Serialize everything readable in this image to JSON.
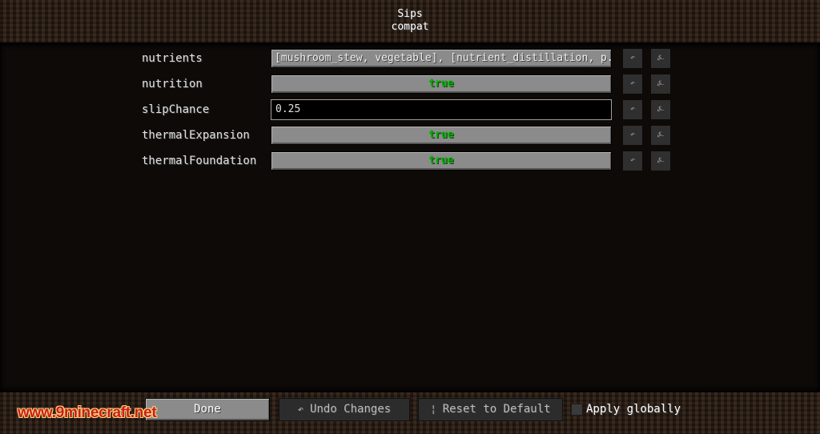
{
  "header": {
    "title": "Sips",
    "subtitle": "compat"
  },
  "entries": [
    {
      "label": "nutrients",
      "type": "list",
      "value": "[mushroom_stew, vegetable], [nutrient_distillation, p..."
    },
    {
      "label": "nutrition",
      "type": "boolean",
      "value": "true"
    },
    {
      "label": "slipChance",
      "type": "text",
      "value": "0.25"
    },
    {
      "label": "thermalExpansion",
      "type": "boolean",
      "value": "true"
    },
    {
      "label": "thermalFoundation",
      "type": "boolean",
      "value": "true"
    }
  ],
  "row_icons": {
    "undo": "↶",
    "reset": "⍼"
  },
  "footer": {
    "done_label": "Done",
    "undo_label": "Undo Changes",
    "undo_icon": "↶",
    "reset_label": "Reset to Default",
    "reset_icon": "¦",
    "apply_globally_label": "Apply globally",
    "apply_globally_checked": false
  },
  "watermark": "www.9minecraft.net",
  "colors": {
    "boolean_true": "#00b000",
    "button_gray": "#8b8b8b",
    "dark_button": "#2c2c2c"
  }
}
